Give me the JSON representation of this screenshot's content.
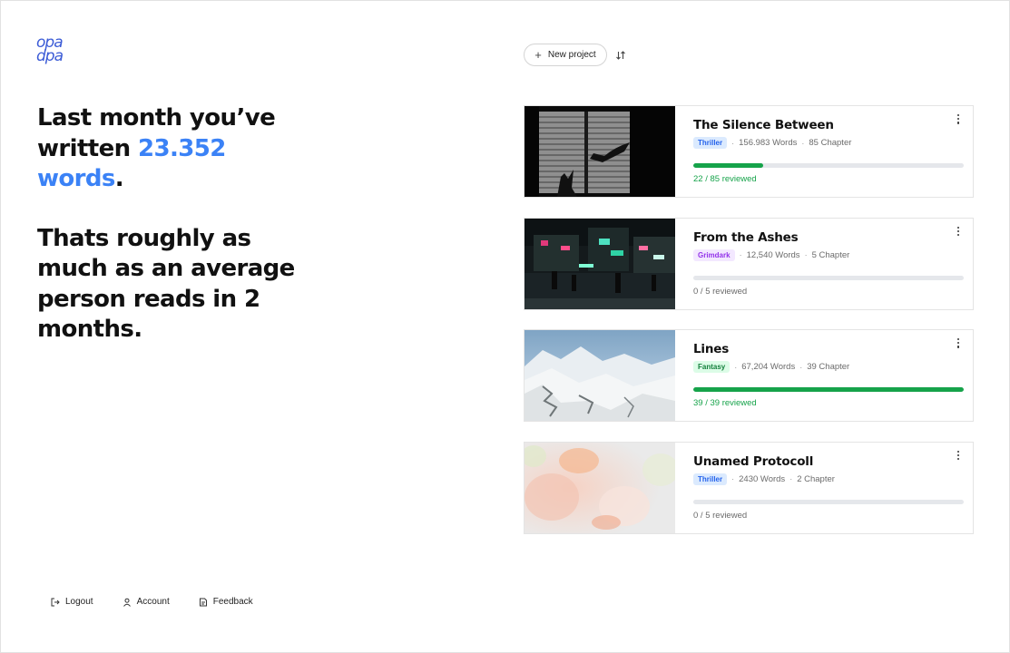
{
  "logo": {
    "line1": "opa",
    "line2": "dpa"
  },
  "headline": {
    "line1_prefix": "Last month you’ve written ",
    "word_count": "23.352",
    "words_label": "words",
    "period": ".",
    "paragraph2": "Thats roughly as much as an average person reads in 2 months."
  },
  "toolbar": {
    "new_project_label": "New project",
    "plus_icon": "plus-icon",
    "sort_icon": "sort-arrows-icon"
  },
  "colors": {
    "accent": "#3b82f6",
    "logo": "#3b5bd6",
    "progress": "#16a34a",
    "thriller_bg": "#dbeafe",
    "thriller_fg": "#2563eb",
    "grimdark_bg": "#f3e8ff",
    "grimdark_fg": "#9333ea",
    "fantasy_bg": "#dcfce7",
    "fantasy_fg": "#15803d"
  },
  "projects": [
    {
      "title": "The Silence Between",
      "genre": "Thriller",
      "words": "156.983 Words",
      "chapters": "85 Chapter",
      "reviewed_text": "22 / 85 reviewed",
      "progress": 0.259
    },
    {
      "title": "From the Ashes",
      "genre": "Grimdark",
      "words": "12,540 Words",
      "chapters": "5 Chapter",
      "reviewed_text": "0 / 5 reviewed",
      "progress": 0
    },
    {
      "title": "Lines",
      "genre": "Fantasy",
      "words": "67,204 Words",
      "chapters": "39 Chapter",
      "reviewed_text": "39 / 39 reviewed",
      "progress": 1
    },
    {
      "title": "Unamed Protocoll",
      "genre": "Thriller",
      "words": "2430 Words",
      "chapters": "2 Chapter",
      "reviewed_text": "0 / 5 reviewed",
      "progress": 0
    }
  ],
  "footer": {
    "logout": "Logout",
    "account": "Account",
    "feedback": "Feedback"
  }
}
